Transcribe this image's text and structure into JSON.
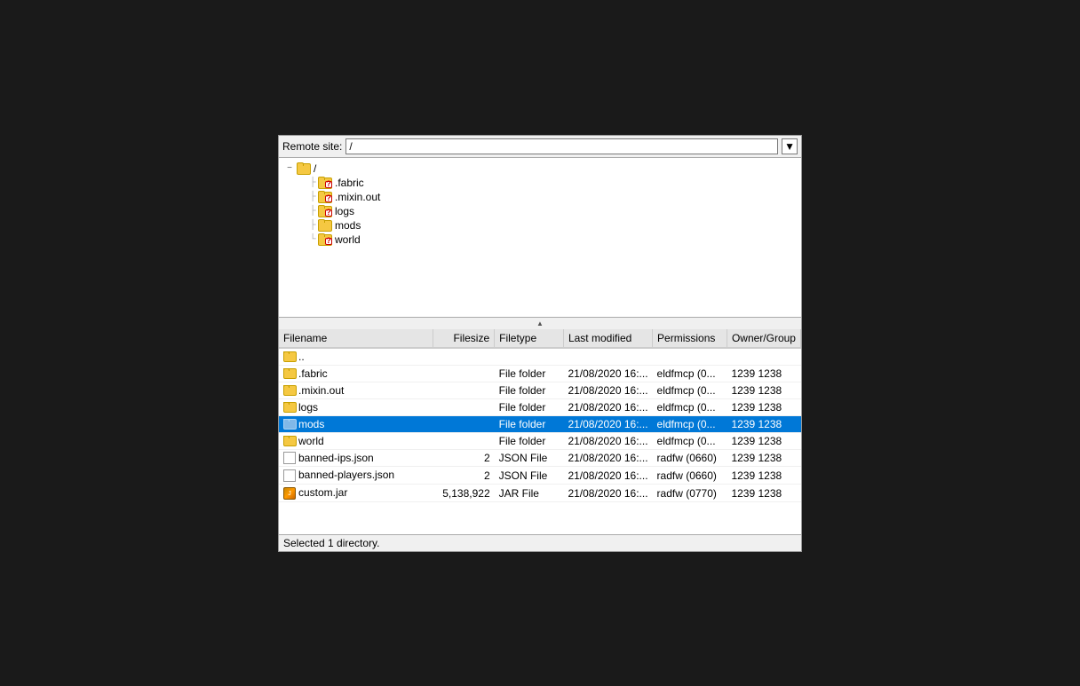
{
  "remote_site": {
    "label": "Remote site:",
    "value": "/",
    "dropdown_arrow": "▼"
  },
  "tree": {
    "root": "/",
    "items": [
      {
        "name": ".fabric",
        "type": "unknown"
      },
      {
        "name": ".mixin.out",
        "type": "unknown"
      },
      {
        "name": "logs",
        "type": "unknown"
      },
      {
        "name": "mods",
        "type": "normal"
      },
      {
        "name": "world",
        "type": "unknown"
      }
    ]
  },
  "table": {
    "columns": [
      "Filename",
      "Filesize",
      "Filetype",
      "Last modified",
      "Permissions",
      "Owner/Group"
    ],
    "rows": [
      {
        "name": "..",
        "filesize": "",
        "filetype": "",
        "lastmod": "",
        "perms": "",
        "owner": "",
        "type": "parent"
      },
      {
        "name": ".fabric",
        "filesize": "",
        "filetype": "File folder",
        "lastmod": "21/08/2020 16:...",
        "perms": "eldfmcp (0...",
        "owner": "1239 1238",
        "type": "folder"
      },
      {
        "name": ".mixin.out",
        "filesize": "",
        "filetype": "File folder",
        "lastmod": "21/08/2020 16:...",
        "perms": "eldfmcp (0...",
        "owner": "1239 1238",
        "type": "folder"
      },
      {
        "name": "logs",
        "filesize": "",
        "filetype": "File folder",
        "lastmod": "21/08/2020 16:...",
        "perms": "eldfmcp (0...",
        "owner": "1239 1238",
        "type": "folder"
      },
      {
        "name": "mods",
        "filesize": "",
        "filetype": "File folder",
        "lastmod": "21/08/2020 16:...",
        "perms": "eldfmcp (0...",
        "owner": "1239 1238",
        "type": "folder",
        "selected": true
      },
      {
        "name": "world",
        "filesize": "",
        "filetype": "File folder",
        "lastmod": "21/08/2020 16:...",
        "perms": "eldfmcp (0...",
        "owner": "1239 1238",
        "type": "folder"
      },
      {
        "name": "banned-ips.json",
        "filesize": "2",
        "filetype": "JSON File",
        "lastmod": "21/08/2020 16:...",
        "perms": "radfw (0660)",
        "owner": "1239 1238",
        "type": "file"
      },
      {
        "name": "banned-players.json",
        "filesize": "2",
        "filetype": "JSON File",
        "lastmod": "21/08/2020 16:...",
        "perms": "radfw (0660)",
        "owner": "1239 1238",
        "type": "file"
      },
      {
        "name": "custom.jar",
        "filesize": "5,138,922",
        "filetype": "JAR File",
        "lastmod": "21/08/2020 16:...",
        "perms": "radfw (0770)",
        "owner": "1239 1238",
        "type": "jar"
      }
    ]
  },
  "status": {
    "text": "Selected 1 directory."
  }
}
